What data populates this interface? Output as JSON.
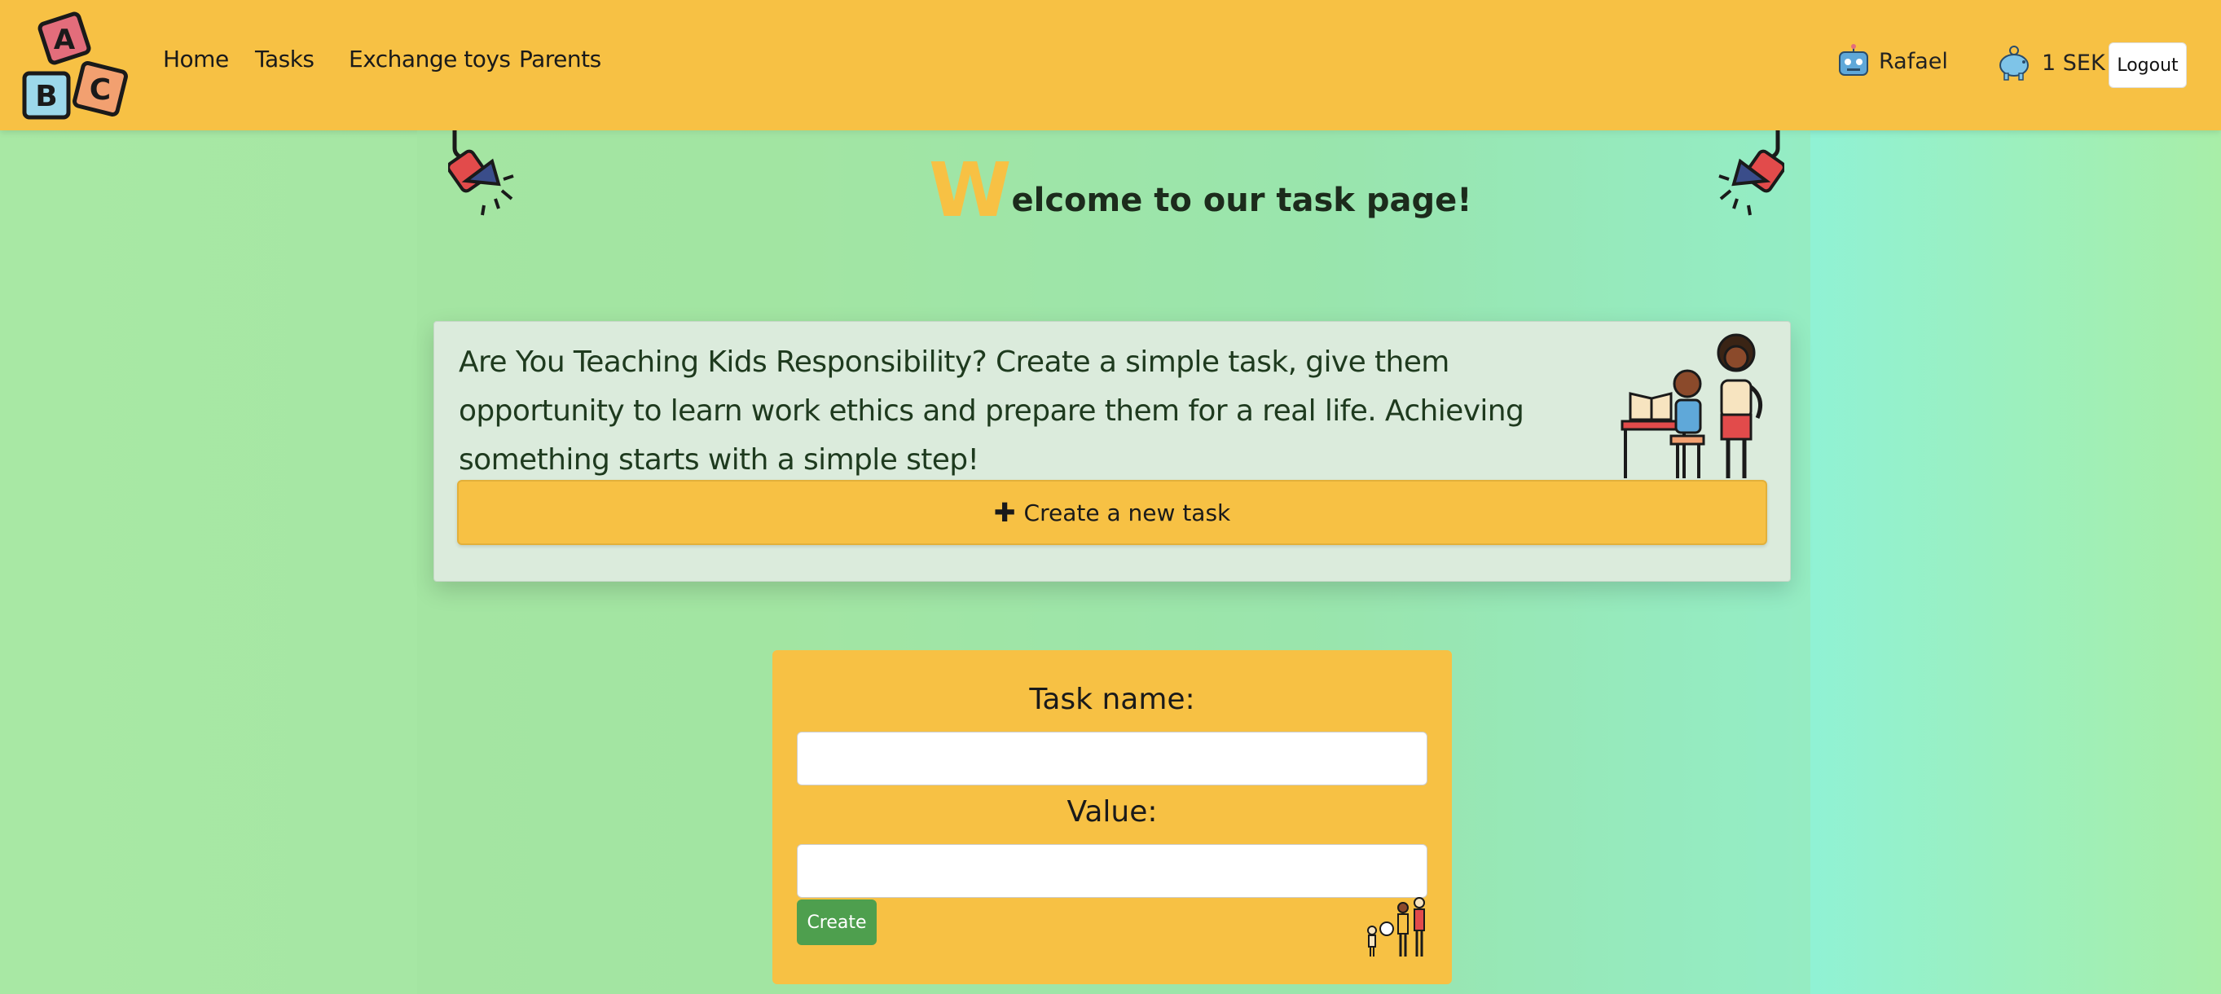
{
  "nav": {
    "links": [
      "Home",
      "Tasks",
      "Exchange toys",
      "Parents"
    ],
    "username": "Rafael",
    "balance": "1 SEK",
    "logout_label": "Logout",
    "logo_letters": [
      "A",
      "B",
      "C"
    ]
  },
  "hero": {
    "first_letter": "W",
    "title_rest": "elcome to our task page!"
  },
  "info": {
    "text": "Are You Teaching Kids Responsibility? Create a simple task, give them opportunity to learn work ethics and prepare them for a real life. Achieving something starts with a simple step!",
    "create_button": "Create a new task"
  },
  "form": {
    "task_label": "Task name:",
    "task_value": "",
    "value_label": "Value:",
    "value_value": "",
    "submit_label": "Create"
  },
  "colors": {
    "navbar": "#f7c144",
    "accent": "#f7c144",
    "submit": "#4e9f4e"
  }
}
